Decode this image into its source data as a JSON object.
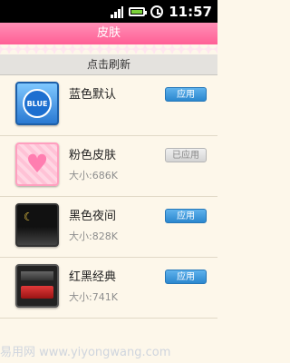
{
  "status_bar": {
    "time": "11:57"
  },
  "header": {
    "title": "皮肤"
  },
  "refresh": {
    "label": "点击刷新"
  },
  "skins": [
    {
      "name": "蓝色默认",
      "size": "",
      "button": "应用",
      "thumb_text": "BLUE",
      "applied": false
    },
    {
      "name": "粉色皮肤",
      "size": "大小:686K",
      "button": "已应用",
      "applied": true
    },
    {
      "name": "黑色夜间",
      "size": "大小:828K",
      "button": "应用",
      "applied": false
    },
    {
      "name": "红黑经典",
      "size": "大小:741K",
      "button": "应用",
      "applied": false
    }
  ],
  "colors": {
    "accent_pink": "#ff6f9f",
    "button_blue": "#2b87cf"
  },
  "watermark": {
    "text": "易用网 www.yiyongwang.com"
  }
}
